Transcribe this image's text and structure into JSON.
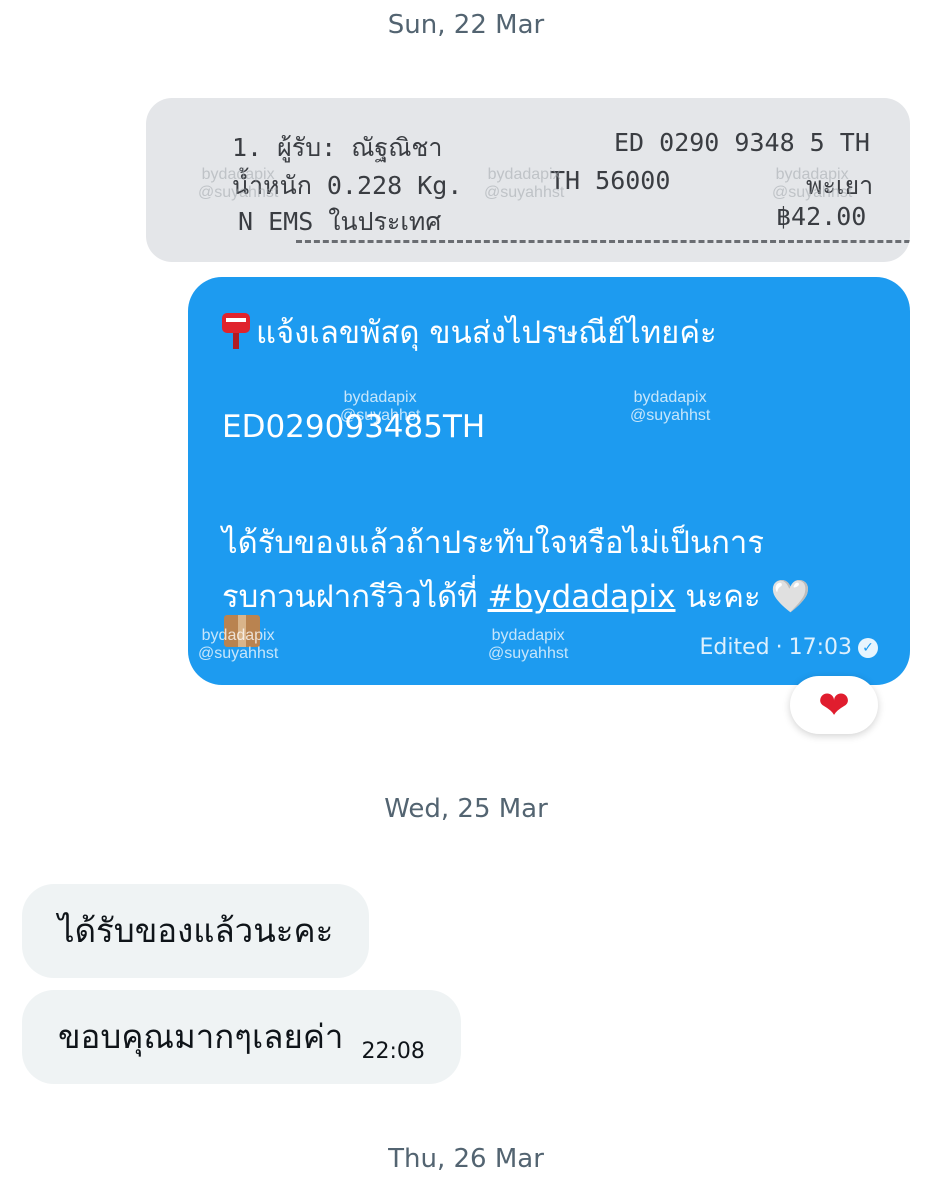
{
  "date_separators": {
    "first": "Sun, 22 Mar",
    "second": "Wed, 25 Mar",
    "third": "Thu, 26 Mar"
  },
  "receipt": {
    "line1_left": "1. ผู้รับ: ณัฐณิชา",
    "line1_right": "ED 0290 9348 5 TH",
    "line2_left": "น้ำหนัก 0.228 Kg.",
    "line2_mid": "TH 56000",
    "line2_right": "พะเยา",
    "line3_left": "N EMS ในประเทศ",
    "line3_right": "฿42.00"
  },
  "watermark": {
    "line1": "bydadapix",
    "line2": "@suyahhst"
  },
  "outgoing_message": {
    "line1": "แจ้งเลขพัสดุ ขนส่งไปรษณีย์ไทยค่ะ",
    "tracking": "ED029093485TH",
    "line3": "ได้รับของแล้วถ้าประทับใจหรือไม่เป็นการ",
    "line4_prefix": "รบกวนฝากรีวิวได้ที่",
    "hashtag": "#bydadapix",
    "line4_suffix": "นะคะ",
    "status": "Edited",
    "separator": "·",
    "time": "17:03",
    "reaction": "❤"
  },
  "incoming_messages": [
    {
      "text": "ได้รับของแล้วนะคะ",
      "time": ""
    },
    {
      "text": "ขอบคุณมากๆเลยค่า",
      "time": "22:08"
    }
  ],
  "icons": {
    "postbox": "postbox-icon",
    "white_heart": "🤍",
    "package": "package-icon",
    "read_check": "✓"
  },
  "colors": {
    "accent": "#1d9bf0",
    "incoming_bg": "#eff3f4",
    "date_text": "#536471",
    "reaction_heart": "#e01d2e"
  }
}
